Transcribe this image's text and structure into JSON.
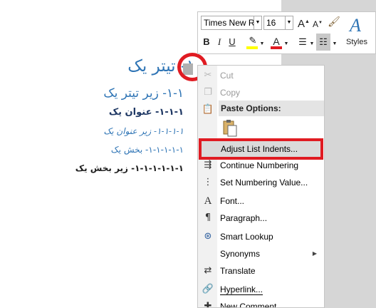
{
  "document": {
    "headings": [
      {
        "text": "١- تیتر یک"
      },
      {
        "text": "١-١- زیر تیتر یک"
      },
      {
        "text": "١-١-١- عنوان یک"
      },
      {
        "text": "١-١-١-١- زیر عنوان یک"
      },
      {
        "text": "١-١-١-١-١- بخش یک"
      },
      {
        "text": "١-١-١-١-١-١- زیر بخش یک"
      }
    ]
  },
  "mini_toolbar": {
    "font_name": "Times New Ro",
    "font_size": "16",
    "bold": "B",
    "italic": "I",
    "underline": "U",
    "font_color": "A",
    "styles_label": "Styles",
    "highlight_color": "#ffff00",
    "font_color_bar": "#e01b22"
  },
  "context_menu": {
    "items": [
      {
        "label": "Cut",
        "icon": "scissors-icon",
        "disabled": true
      },
      {
        "label": "Copy",
        "icon": "copy-icon",
        "disabled": true
      },
      {
        "label": "Paste Options:",
        "icon": "paste-icon",
        "header": true
      },
      {
        "label": "Adjust List Indents...",
        "icon": "",
        "highlighted": true
      },
      {
        "label": "Continue Numbering",
        "icon": "continue-numbering-icon"
      },
      {
        "label": "Set Numbering Value...",
        "icon": "set-numbering-icon"
      },
      {
        "label": "Font...",
        "icon": "font-icon"
      },
      {
        "label": "Paragraph...",
        "icon": "paragraph-icon"
      },
      {
        "label": "Smart Lookup",
        "icon": "smart-lookup-icon"
      },
      {
        "label": "Synonyms",
        "icon": "",
        "submenu": true
      },
      {
        "label": "Translate",
        "icon": "translate-icon"
      },
      {
        "label": "Hyperlink...",
        "icon": "hyperlink-icon"
      },
      {
        "label": "New Comment",
        "icon": "comment-icon"
      }
    ]
  },
  "colors": {
    "highlight_box": "#e01b22",
    "heading_blue": "#2e74b5"
  }
}
